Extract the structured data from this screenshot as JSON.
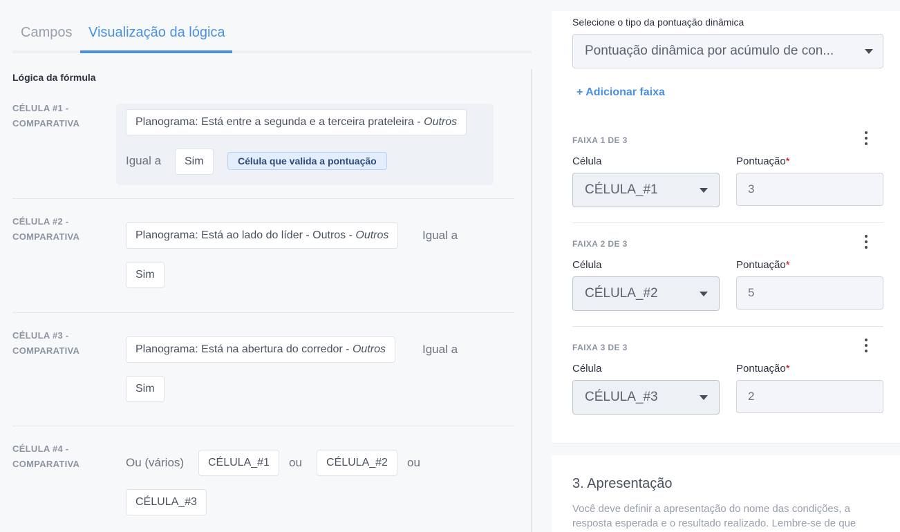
{
  "tabs": [
    {
      "label": "Campos",
      "active": false
    },
    {
      "label": "Visualização da lógica",
      "active": true
    }
  ],
  "logic": {
    "section_title": "Lógica da fórmula",
    "cells": [
      {
        "title": "CÉLULA #1 - COMPARATIVA",
        "condition_text": "Planograma: Está entre a segunda e a terceira prateleira - ",
        "condition_suffix": "Outros",
        "operator": "Igual a",
        "value": "Sim",
        "badge": "Célula que valida a pontuação"
      },
      {
        "title": "CÉLULA #2 - COMPARATIVA",
        "condition_text": "Planograma: Está ao lado do líder - Outros - ",
        "condition_suffix": "Outros",
        "operator": "Igual a",
        "value": "Sim"
      },
      {
        "title": "CÉLULA #3 - COMPARATIVA",
        "condition_text": "Planograma: Está na abertura do corredor - ",
        "condition_suffix": "Outros",
        "operator": "Igual a",
        "value": "Sim"
      },
      {
        "title": "CÉLULA #4 - COMPARATIVA",
        "operator": "Ou (vários)",
        "refs": [
          "CÉLULA_#1",
          "CÉLULA_#2",
          "CÉLULA_#3"
        ],
        "joiner": "ou"
      }
    ]
  },
  "scoring": {
    "type_label": "Selecione o tipo da pontuação dinâmica",
    "type_value": "Pontuação dinâmica por acúmulo de con...",
    "add_band": "+ Adicionar faixa",
    "cell_label": "Célula",
    "score_label": "Pontuação",
    "required_mark": "*",
    "bands": [
      {
        "title": "FAIXA 1 DE 3",
        "cell": "CÉLULA_#1",
        "score": "3"
      },
      {
        "title": "FAIXA 2 DE 3",
        "cell": "CÉLULA_#2",
        "score": "5"
      },
      {
        "title": "FAIXA 3 DE 3",
        "cell": "CÉLULA_#3",
        "score": "2"
      }
    ]
  },
  "presentation": {
    "heading": "3. Apresentação",
    "description": "Você deve definir a apresentação do nome das condições, a resposta esperada e o resultado realizado. Lembre-se de que"
  },
  "colors": {
    "accent": "#4a90e2",
    "badge_bg": "#e3edfc",
    "required": "#d0021b"
  }
}
